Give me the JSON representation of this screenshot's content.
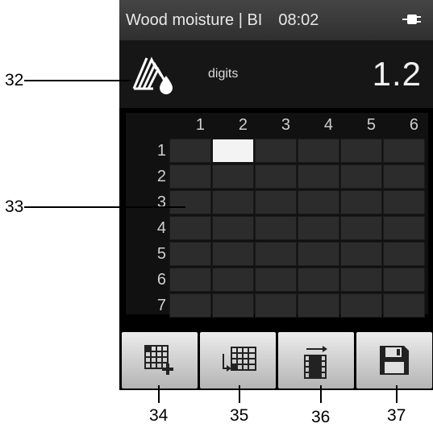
{
  "header": {
    "title": "Wood moisture | BI 08:02",
    "power_icon": "plug-icon"
  },
  "readout": {
    "mode_icon": "wood-moisture-icon",
    "unit": "digits",
    "value": "1.2"
  },
  "grid": {
    "columns": [
      "1",
      "2",
      "3",
      "4",
      "5",
      "6"
    ],
    "rows": [
      "1",
      "2",
      "3",
      "4",
      "5",
      "6",
      "7"
    ],
    "active_cell": {
      "row": 1,
      "column": 2
    }
  },
  "toolbar": {
    "buttons": [
      {
        "icon": "add-grid-icon"
      },
      {
        "icon": "move-grid-icon"
      },
      {
        "icon": "insert-column-icon"
      },
      {
        "icon": "save-icon"
      }
    ]
  },
  "callouts": {
    "c32": "32",
    "c33": "33",
    "c34": "34",
    "c35": "35",
    "c36": "36",
    "c37": "37"
  },
  "colors": {
    "screen_bg": "#000000",
    "active_cell": "#f3f3f3",
    "cell": "#2c2c2c"
  }
}
